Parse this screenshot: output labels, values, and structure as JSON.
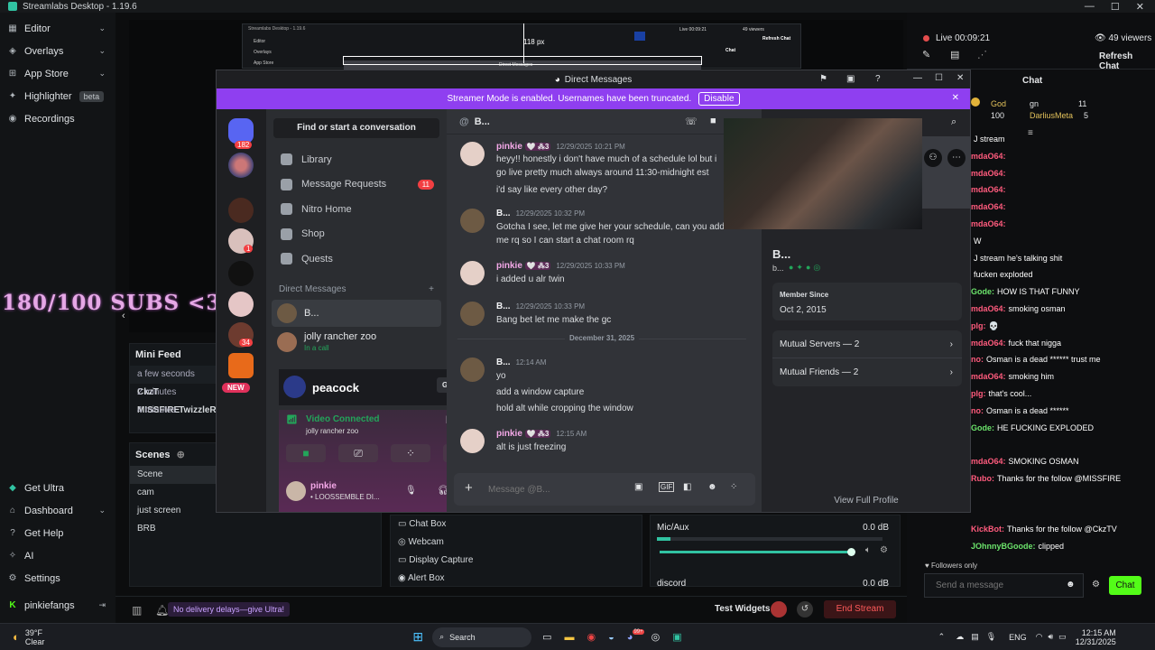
{
  "app": {
    "title": "Streamlabs Desktop - 1.19.6"
  },
  "sidebar": {
    "top_items": [
      {
        "label": "Editor",
        "icon": "editor-icon"
      },
      {
        "label": "Overlays",
        "icon": "overlays-icon"
      },
      {
        "label": "App Store",
        "icon": "store-icon"
      },
      {
        "label": "Highlighter",
        "icon": "highlighter-icon",
        "badge": "beta"
      },
      {
        "label": "Recordings",
        "icon": "recordings-icon"
      }
    ],
    "bottom_items": [
      {
        "label": "Get Ultra",
        "icon": "ultra-icon"
      },
      {
        "label": "Dashboard",
        "icon": "dashboard-icon"
      },
      {
        "label": "Get Help",
        "icon": "help-icon"
      },
      {
        "label": "AI",
        "icon": "ai-icon"
      },
      {
        "label": "Settings",
        "icon": "gear-icon"
      }
    ],
    "user": "pinkiefangs"
  },
  "preview": {
    "overlay_text": "180/100 SUBS <3",
    "zoom_readout": "118 px",
    "mini_title": "Streamlabs Desktop - 1.19.6",
    "mini_dm": "Direct Messages",
    "mini_live": "Live 00:09:21",
    "mini_viewers": "49 viewers",
    "mini_refresh": "Refresh Chat",
    "mini_chat": "Chat",
    "mini_nav": [
      "Editor",
      "Overlays",
      "App Store"
    ]
  },
  "mini_feed": {
    "title": "Mini Feed",
    "rows": [
      {
        "time": "a few seconds",
        "name": "CkzT"
      },
      {
        "time": "2 minutes",
        "name": "MISSFIRE"
      },
      {
        "time": "4 minutes",
        "name": "TwizzleR"
      }
    ]
  },
  "scenes": {
    "title": "Scenes",
    "items": [
      "Scene",
      "cam",
      "just screen",
      "BRB"
    ]
  },
  "sources": {
    "items": [
      "Chat Box",
      "Webcam",
      "Display Capture",
      "Alert Box"
    ]
  },
  "mixer": {
    "tracks": [
      {
        "name": "Mic/Aux",
        "level": "0.0 dB"
      },
      {
        "name": "discord",
        "level": "0.0 dB"
      }
    ]
  },
  "footer": {
    "promo": "No delivery delays—give Ultra!",
    "test_widgets": "Test Widgets",
    "end_stream": "End Stream"
  },
  "stream": {
    "live": "Live",
    "time": "00:09:21",
    "viewers": "49 viewers",
    "refresh": "Refresh Chat"
  },
  "chat": {
    "title": "Chat",
    "top": [
      {
        "name": "God",
        "count": "100"
      },
      {
        "name": "gn",
        "count": "11"
      },
      {
        "name": "DarliusMeta",
        "count": "5"
      }
    ],
    "lines": [
      {
        "user": "",
        "text": "J stream"
      },
      {
        "user": "mdaO64:",
        "text": ""
      },
      {
        "user": "mdaO64:",
        "text": ""
      },
      {
        "user": "mdaO64:",
        "text": ""
      },
      {
        "user": "mdaO64:",
        "text": ""
      },
      {
        "user": "mdaO64:",
        "text": ""
      },
      {
        "user": "",
        "text": "W"
      },
      {
        "user": "",
        "text": "J stream he's talking shit"
      },
      {
        "user": "",
        "text": "fucken exploded"
      },
      {
        "user": "Gode:",
        "text": "HOW IS THAT FUNNY",
        "cls": "g"
      },
      {
        "user": "mdaO64:",
        "text": "smoking osman"
      },
      {
        "user": "plg:",
        "text": "💀"
      },
      {
        "user": "mdaO64:",
        "text": "fuck that nigga"
      },
      {
        "user": "no:",
        "text": "Osman is a dead ****** trust me"
      },
      {
        "user": "mdaO64:",
        "text": "smoking him"
      },
      {
        "user": "plg:",
        "text": "that's cool..."
      },
      {
        "user": "no:",
        "text": "Osman is a dead ******"
      },
      {
        "user": "Gode:",
        "text": "HE FUCKING EXPLODED",
        "cls": "g"
      },
      {
        "user": "",
        "text": ""
      },
      {
        "user": "mdaO64:",
        "text": "SMOKING OSMAN"
      },
      {
        "user": "Rubo:",
        "text": "Thanks for the follow @MISSFIRE"
      },
      {
        "user": "",
        "text": ""
      },
      {
        "user": "",
        "text": ""
      },
      {
        "user": "KickBot:",
        "text": "Thanks for the follow @CkzTV"
      },
      {
        "user": "JOhnnyBGoode:",
        "text": "clipped",
        "cls": "g"
      }
    ],
    "followers_only": "Followers only",
    "placeholder": "Send a message",
    "send": "Chat"
  },
  "discord": {
    "window_title": "Direct Messages",
    "banner": "Streamer Mode is enabled. Usernames have been truncated.",
    "banner_btn": "Disable",
    "guild_badges": [
      "182",
      "1",
      "34"
    ],
    "new_label": "NEW",
    "search": "Find or start a conversation",
    "nav": [
      {
        "label": "Library"
      },
      {
        "label": "Message Requests",
        "count": "11"
      },
      {
        "label": "Nitro Home"
      },
      {
        "label": "Shop"
      },
      {
        "label": "Quests"
      }
    ],
    "dm_header": "Direct Messages",
    "dms": [
      {
        "name": "B...",
        "status": ""
      },
      {
        "name": "jolly rancher zoo",
        "status": "In a call"
      }
    ],
    "promo": {
      "brand": "peacock",
      "cta": "Get Reward!"
    },
    "voice": {
      "status": "Video Connected",
      "channel": "jolly rancher zoo"
    },
    "user": {
      "name": "pinkie",
      "status": "• LOOSSEMBLE DI..."
    },
    "chat_header": "B...",
    "messages": [
      {
        "name": "pinkie",
        "tag": "🤍 ⁂3",
        "time": "12/29/2025 10:21 PM",
        "lines": [
          "heyy!! honestly i don't have much of a schedule lol but i",
          "go live pretty much always around 11:30-midnight est",
          "i'd say like every other day?"
        ]
      },
      {
        "name": "B...",
        "tag": "",
        "time": "12/29/2025 10:32 PM",
        "lines": [
          "Gotcha I see, let me give her your schedule, can you add",
          "me rq so I can start a chat room rq"
        ]
      },
      {
        "name": "pinkie",
        "tag": "🤍 ⁂3",
        "time": "12/29/2025 10:33 PM",
        "lines": [
          "i added u alr twin"
        ]
      },
      {
        "name": "B...",
        "tag": "",
        "time": "12/29/2025 10:33 PM",
        "lines": [
          "Bang bet let me make the gc"
        ]
      },
      {
        "name": "B...",
        "tag": "",
        "time": "12:14 AM",
        "lines": [
          "yo",
          "add a window capture",
          "hold alt while cropping the window"
        ]
      },
      {
        "name": "pinkie",
        "tag": "🤍 ⁂3",
        "time": "12:15 AM",
        "lines": [
          "alt is just freezing"
        ]
      }
    ],
    "divider": "December 31, 2025",
    "input_placeholder": "Message @B...",
    "profile": {
      "name": "B...",
      "sub": "b...",
      "member_since_label": "Member Since",
      "member_since": "Oct 2, 2015",
      "mutual_servers": "Mutual Servers — 2",
      "mutual_friends": "Mutual Friends — 2",
      "view_full": "View Full Profile"
    }
  },
  "taskbar": {
    "temp": "39°F",
    "weather": "Clear",
    "search": "Search",
    "lang": "ENG",
    "time": "12:15 AM",
    "date": "12/31/2025",
    "store_badge": "99+"
  },
  "colors": {
    "accent": "#31c3a2",
    "discord_brand": "#5865f2",
    "streamer_banner": "#8f3ff0",
    "live": "#e44d4d"
  }
}
